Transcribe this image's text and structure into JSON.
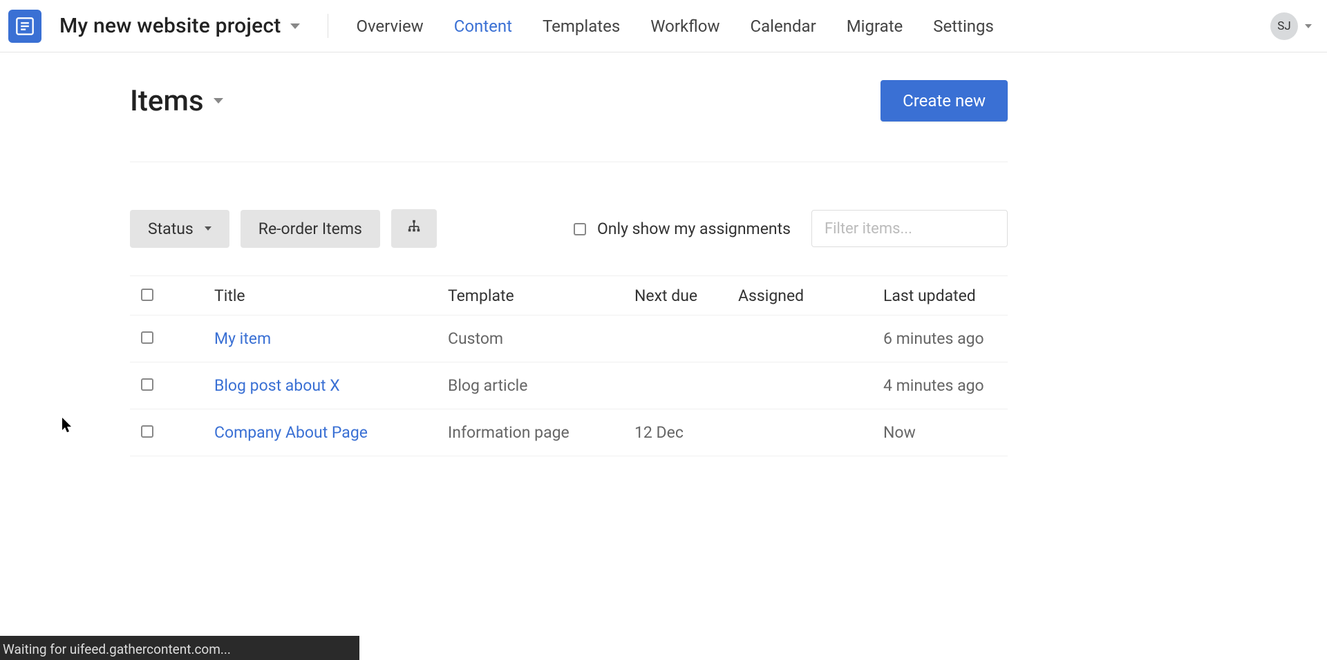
{
  "header": {
    "project_title": "My new website project",
    "nav": [
      {
        "label": "Overview",
        "active": false
      },
      {
        "label": "Content",
        "active": true
      },
      {
        "label": "Templates",
        "active": false
      },
      {
        "label": "Workflow",
        "active": false
      },
      {
        "label": "Calendar",
        "active": false
      },
      {
        "label": "Migrate",
        "active": false
      },
      {
        "label": "Settings",
        "active": false
      }
    ],
    "avatar_initials": "SJ"
  },
  "page": {
    "title": "Items",
    "create_button": "Create new"
  },
  "toolbar": {
    "status_button": "Status",
    "reorder_button": "Re-order Items",
    "assignments_label": "Only show my assignments",
    "filter_placeholder": "Filter items..."
  },
  "table": {
    "columns": {
      "title": "Title",
      "template": "Template",
      "next_due": "Next due",
      "assigned": "Assigned",
      "last_updated": "Last updated"
    },
    "rows": [
      {
        "status_color": "grey",
        "title": "My item",
        "template": "Custom",
        "next_due": "",
        "assigned": "",
        "last_updated": "6 minutes ago"
      },
      {
        "status_color": "grey",
        "title": "Blog post about X",
        "template": "Blog article",
        "next_due": "",
        "assigned": "",
        "last_updated": "4 minutes ago"
      },
      {
        "status_color": "magenta",
        "title": "Company About Page",
        "template": "Information page",
        "next_due": "12 Dec",
        "assigned": "",
        "last_updated": "Now"
      }
    ]
  },
  "status_bar": "Waiting for uifeed.gathercontent.com..."
}
